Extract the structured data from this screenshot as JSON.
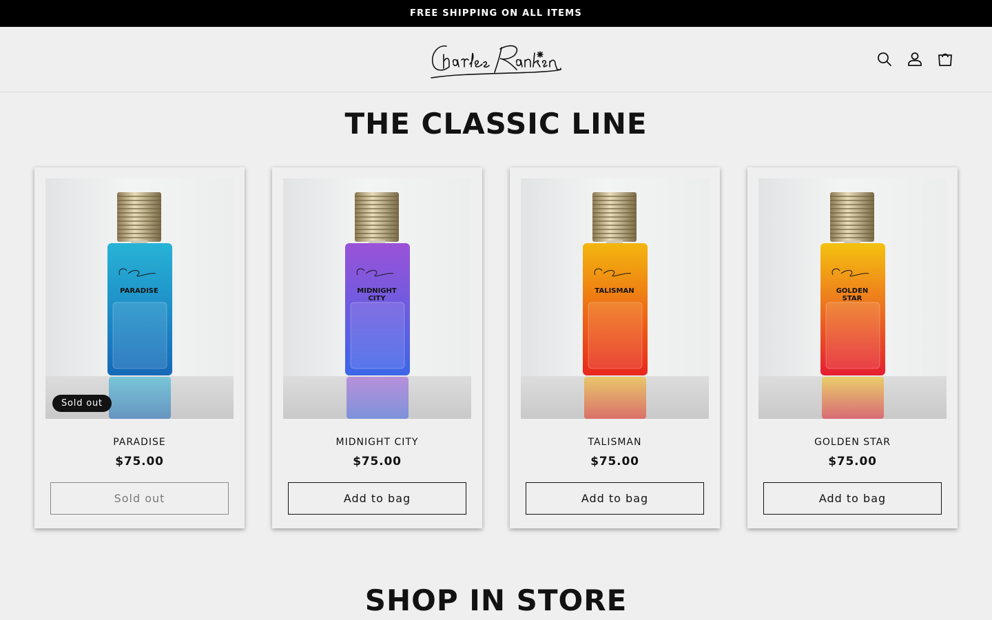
{
  "announcement": "FREE SHIPPING ON ALL ITEMS",
  "header": {
    "logo_text": "Charles Rankin",
    "icons": [
      "search-icon",
      "account-icon",
      "cart-icon"
    ]
  },
  "collection": {
    "title": "THE CLASSIC LINE",
    "products": [
      {
        "name": "PARADISE",
        "label_lines": [
          "PARADISE"
        ],
        "price": "$75.00",
        "button": "Sold out",
        "badge": "Sold out",
        "sold_out": true,
        "color_top": "#27b3d6",
        "color_bottom": "#1569b8"
      },
      {
        "name": "MIDNIGHT CITY",
        "label_lines": [
          "MIDNIGHT",
          "CITY"
        ],
        "price": "$75.00",
        "button": "Add to bag",
        "sold_out": false,
        "color_top": "#9a52d8",
        "color_bottom": "#3d66e8"
      },
      {
        "name": "TALISMAN",
        "label_lines": [
          "TALISMAN"
        ],
        "price": "$75.00",
        "button": "Add to bag",
        "sold_out": false,
        "color_top": "#f3b60e",
        "color_bottom": "#e8271c"
      },
      {
        "name": "GOLDEN STAR",
        "label_lines": [
          "GOLDEN",
          "STAR"
        ],
        "price": "$75.00",
        "button": "Add to bag",
        "sold_out": false,
        "color_top": "#f4c20f",
        "color_bottom": "#e51e30"
      }
    ]
  },
  "next_section": {
    "title": "SHOP IN STORE"
  }
}
